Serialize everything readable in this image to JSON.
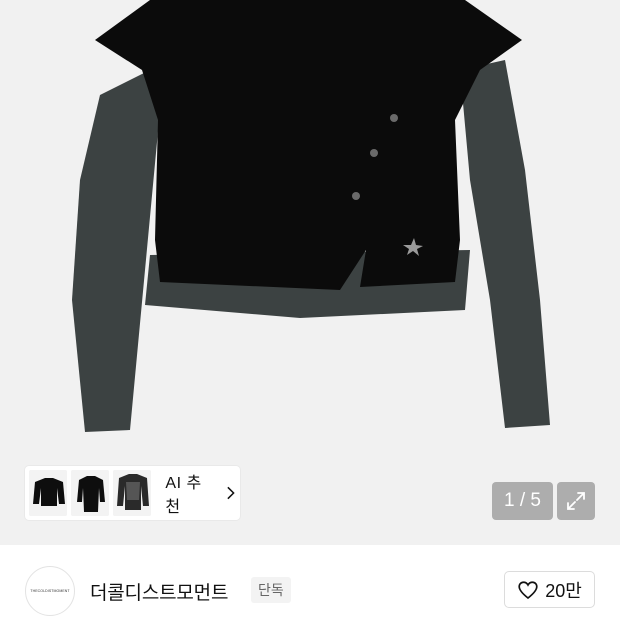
{
  "gallery": {
    "image_alt": "black layered long-sleeve top",
    "pager": {
      "current": "1",
      "separator": " / ",
      "total": "5",
      "text": "1 / 5"
    },
    "expand_icon": "expand-icon"
  },
  "ai_recommend": {
    "label": "AI 추천",
    "thumbnail_count": 3,
    "chevron_icon": "chevron-right-icon"
  },
  "brand": {
    "logo_text": "THECOLDISTMOMENT",
    "name": "더콜디스트모먼트",
    "badge": "단독"
  },
  "like": {
    "icon": "heart-icon",
    "count": "20만"
  },
  "colors": {
    "gallery_bg": "#f1f1f1",
    "overlay": "#969696",
    "garment_black": "#0b0b0b",
    "garment_grey": "#3c4242"
  }
}
